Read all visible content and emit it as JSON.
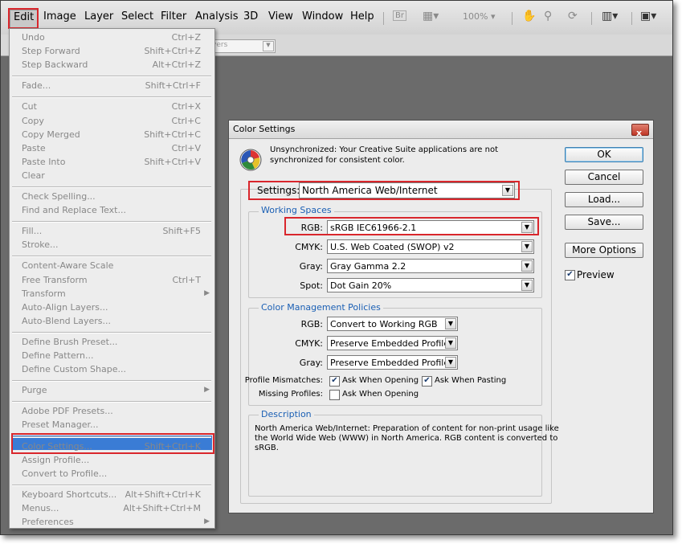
{
  "menubar": {
    "items": [
      "Edit",
      "Image",
      "Layer",
      "Select",
      "Filter",
      "Analysis",
      "3D",
      "View",
      "Window",
      "Help"
    ],
    "zoom": "100%"
  },
  "optbar": {
    "layers_placeholder": "yers"
  },
  "edit_menu": {
    "groups": [
      [
        {
          "label": "Undo",
          "shortcut": "Ctrl+Z"
        },
        {
          "label": "Step Forward",
          "shortcut": "Shift+Ctrl+Z"
        },
        {
          "label": "Step Backward",
          "shortcut": "Alt+Ctrl+Z"
        }
      ],
      [
        {
          "label": "Fade...",
          "shortcut": "Shift+Ctrl+F"
        }
      ],
      [
        {
          "label": "Cut",
          "shortcut": "Ctrl+X"
        },
        {
          "label": "Copy",
          "shortcut": "Ctrl+C"
        },
        {
          "label": "Copy Merged",
          "shortcut": "Shift+Ctrl+C"
        },
        {
          "label": "Paste",
          "shortcut": "Ctrl+V"
        },
        {
          "label": "Paste Into",
          "shortcut": "Shift+Ctrl+V"
        },
        {
          "label": "Clear",
          "shortcut": ""
        }
      ],
      [
        {
          "label": "Check Spelling...",
          "shortcut": ""
        },
        {
          "label": "Find and Replace Text...",
          "shortcut": ""
        }
      ],
      [
        {
          "label": "Fill...",
          "shortcut": "Shift+F5"
        },
        {
          "label": "Stroke...",
          "shortcut": ""
        }
      ],
      [
        {
          "label": "Content-Aware Scale",
          "shortcut": ""
        },
        {
          "label": "Free Transform",
          "shortcut": "Ctrl+T"
        },
        {
          "label": "Transform",
          "shortcut": ""
        },
        {
          "label": "Auto-Align Layers...",
          "shortcut": ""
        },
        {
          "label": "Auto-Blend Layers...",
          "shortcut": ""
        }
      ],
      [
        {
          "label": "Define Brush Preset...",
          "shortcut": ""
        },
        {
          "label": "Define Pattern...",
          "shortcut": ""
        },
        {
          "label": "Define Custom Shape...",
          "shortcut": ""
        }
      ],
      [
        {
          "label": "Purge",
          "shortcut": ""
        }
      ],
      [
        {
          "label": "Adobe PDF Presets...",
          "shortcut": ""
        },
        {
          "label": "Preset Manager...",
          "shortcut": ""
        }
      ],
      [
        {
          "label": "Color Settings...",
          "shortcut": "Shift+Ctrl+K"
        },
        {
          "label": "Assign Profile...",
          "shortcut": ""
        },
        {
          "label": "Convert to Profile...",
          "shortcut": ""
        }
      ],
      [
        {
          "label": "Keyboard Shortcuts...",
          "shortcut": "Alt+Shift+Ctrl+K"
        },
        {
          "label": "Menus...",
          "shortcut": "Alt+Shift+Ctrl+M"
        },
        {
          "label": "Preferences",
          "shortcut": ""
        }
      ]
    ]
  },
  "dialog": {
    "title": "Color Settings",
    "close": "x",
    "sync_message_line1": "Unsynchronized: Your Creative Suite applications are not",
    "sync_message_line2": "synchronized for consistent color.",
    "settings_label": "Settings:",
    "settings_value": "North America Web/Internet",
    "working_spaces": {
      "title": "Working Spaces",
      "rgb_label": "RGB:",
      "rgb_value": "sRGB IEC61966-2.1",
      "cmyk_label": "CMYK:",
      "cmyk_value": "U.S. Web Coated (SWOP) v2",
      "gray_label": "Gray:",
      "gray_value": "Gray Gamma 2.2",
      "spot_label": "Spot:",
      "spot_value": "Dot Gain 20%"
    },
    "policies": {
      "title": "Color Management Policies",
      "rgb_label": "RGB:",
      "rgb_value": "Convert to Working RGB",
      "cmyk_label": "CMYK:",
      "cmyk_value": "Preserve Embedded Profiles",
      "gray_label": "Gray:",
      "gray_value": "Preserve Embedded Profiles",
      "mismatch_label": "Profile Mismatches:",
      "ask_opening": "Ask When Opening",
      "ask_pasting": "Ask When Pasting",
      "missing_label": "Missing Profiles:",
      "missing_ask_opening": "Ask When Opening"
    },
    "description": {
      "title": "Description",
      "line1": "North America Web/Internet:  Preparation of content for non-print usage like",
      "line2": "the World Wide Web (WWW) in North America. RGB content is converted to",
      "line3": "sRGB."
    },
    "buttons": {
      "ok": "OK",
      "cancel": "Cancel",
      "load": "Load...",
      "save": "Save...",
      "more": "More Options"
    },
    "preview_label": "Preview"
  },
  "colors": {
    "highlight": "#3a7cd5",
    "annotation_red": "#d9262c",
    "group_title": "#1a5fb4"
  }
}
